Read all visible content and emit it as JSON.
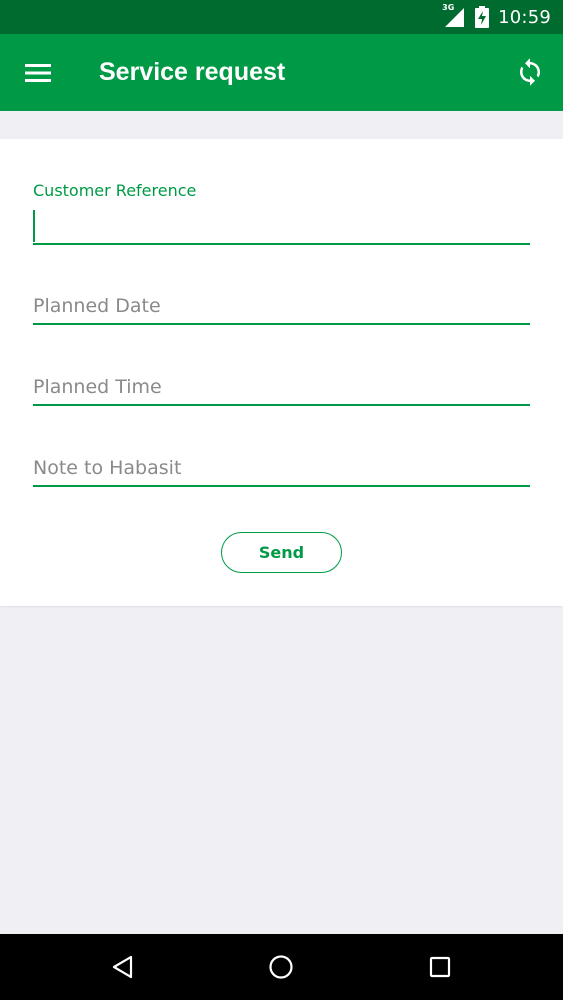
{
  "status_bar": {
    "network_label": "3G",
    "time": "10:59",
    "icons": [
      "signal-icon",
      "battery-icon"
    ]
  },
  "app_bar": {
    "title": "Service request",
    "icons": [
      "menu-icon",
      "refresh-icon"
    ]
  },
  "form": {
    "fields": [
      {
        "label": "Customer Reference",
        "value": ""
      },
      {
        "placeholder": "Planned Date",
        "value": ""
      },
      {
        "placeholder": "Planned Time",
        "value": ""
      },
      {
        "placeholder": "Note to Habasit",
        "value": ""
      }
    ],
    "send_label": "Send"
  },
  "nav_bar": {
    "icons": [
      "back-icon",
      "home-icon",
      "recents-icon"
    ]
  },
  "colors": {
    "status_bar": "#006b2f",
    "app_bar": "#009a46",
    "accent": "#009a46",
    "background": "#efeff4",
    "card": "#ffffff",
    "placeholder_text": "#8a8a8a",
    "nav_bar": "#000000"
  }
}
